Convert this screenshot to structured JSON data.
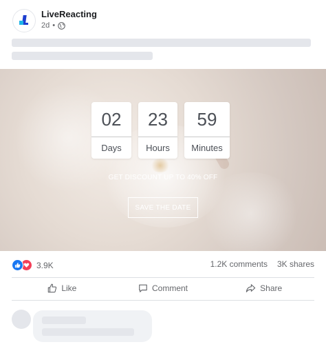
{
  "post": {
    "page_name": "LiveReacting",
    "time": "2d",
    "separator": "•",
    "audience_icon": "globe-icon"
  },
  "countdown": {
    "days": {
      "value": "02",
      "label": "Days"
    },
    "hours": {
      "value": "23",
      "label": "Hours"
    },
    "minutes": {
      "value": "59",
      "label": "Minutes"
    }
  },
  "banner": {
    "offer_text": "GET DISCOUNT UP TO 40% OFF",
    "cta_label": "SAVE THE DATE"
  },
  "stats": {
    "reactions_count": "3.9K",
    "comments": "1.2K comments",
    "shares": "3K shares",
    "reaction_icons": [
      "like-icon",
      "love-icon"
    ]
  },
  "actions": {
    "like": "Like",
    "comment": "Comment",
    "share": "Share"
  },
  "colors": {
    "like_blue": "#1877f2",
    "love_red": "#f33e58",
    "muted_text": "#65676b",
    "skeleton": "#e4e6eb"
  }
}
